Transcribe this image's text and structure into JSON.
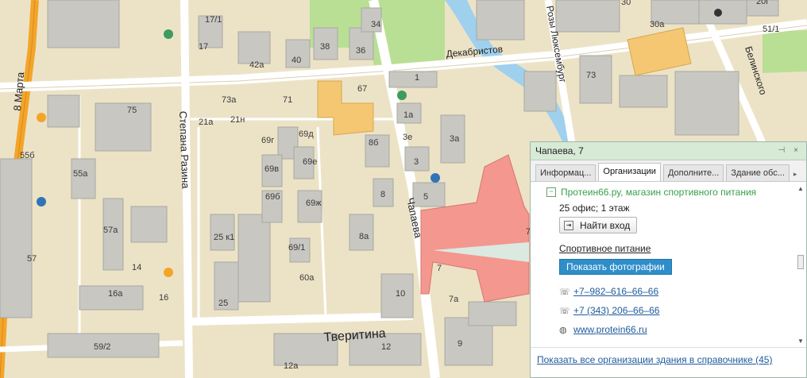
{
  "map": {
    "streets": {
      "vosmoe_marta": "8 Марта",
      "stepana_razina": "Степана Разина",
      "chapaeva": "Чапаева",
      "dekabristov": "Декабристов",
      "rozy_lyuksemburg": "Розы Люксембург",
      "belinskogo": "Белинского",
      "tveritina": "Тверитина"
    },
    "house_numbers": {
      "h17_1": "17/1",
      "h17": "17",
      "h42a": "42а",
      "h40": "40",
      "h38": "38",
      "h36": "36",
      "h34": "34",
      "h30": "30",
      "h20g": "20г",
      "h30a": "30а",
      "h51_1": "51/1",
      "h73": "73",
      "h75": "75",
      "h73a": "73а",
      "h71": "71",
      "h67": "67",
      "h1": "1",
      "h21a": "21а",
      "h21n": "21н",
      "h1a": "1а",
      "h3e": "3е",
      "h3a": "3а",
      "h3": "3",
      "h5": "5",
      "h69g": "69г",
      "h69d": "69д",
      "h69e": "69е",
      "h69v": "69в",
      "h8b": "8б",
      "h69b": "69б",
      "h69zh": "69ж",
      "h8": "8",
      "h8a": "8а",
      "h55b": "55б",
      "h55a": "55а",
      "h57a": "57а",
      "h25k1": "25 к1",
      "h69_1": "69/1",
      "h57": "57",
      "h14": "14",
      "h7": "7",
      "h7edge": "7",
      "h60a": "60а",
      "h16a": "16а",
      "h16": "16",
      "h25": "25",
      "h10": "10",
      "h7a": "7а",
      "h59_2": "59/2",
      "h12": "12",
      "h9": "9",
      "h12a": "12а"
    }
  },
  "popup": {
    "title": "Чапаева, 7",
    "controls": {
      "pin": "⊣",
      "close": "×"
    },
    "tabs": [
      "Информац...",
      "Организации",
      "Дополните...",
      "Здание обс..."
    ],
    "active_tab": "Организации",
    "organization": {
      "name": "Протеин66.ру, магазин спортивного питания",
      "office": "25 офис; 1 этаж",
      "find_entrance": "Найти вход",
      "category": "Спортивное питание",
      "show_photos": "Показать фотографии",
      "phone1": "+7–982–616–66–66",
      "phone2": "+7 (343) 206–66–66",
      "website": "www.protein66.ru"
    },
    "footer_link": "Показать все организации здания в справочнике (45)"
  },
  "colors": {
    "map_background": "#ece3c7",
    "road": "#ffffff",
    "highway": "#f3a52a",
    "river": "#9fd0ee",
    "park": "#b9df95",
    "highlight_building": "#f4978e",
    "selected_building": "#f5c772",
    "panel_header": "#d6ead6",
    "link": "#1f5b9c",
    "accent_green": "#38a04b"
  }
}
